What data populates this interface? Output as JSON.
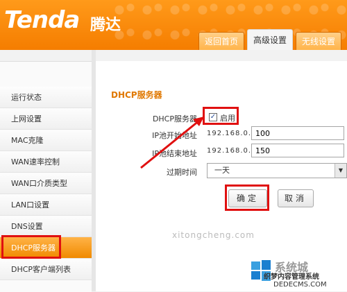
{
  "header": {
    "logo": "Tenda",
    "logo_cn": "腾达",
    "tabs": [
      {
        "label": "返回首页",
        "active": false
      },
      {
        "label": "高级设置",
        "active": true
      },
      {
        "label": "无线设置",
        "active": false
      }
    ]
  },
  "sidebar": {
    "items": [
      {
        "label": "运行状态"
      },
      {
        "label": "上网设置"
      },
      {
        "label": "MAC克隆"
      },
      {
        "label": "WAN速率控制"
      },
      {
        "label": "WAN口介质类型"
      },
      {
        "label": "LAN口设置"
      },
      {
        "label": "DNS设置"
      },
      {
        "label": "DHCP服务器",
        "active": true
      },
      {
        "label": "DHCP客户端列表"
      }
    ]
  },
  "main": {
    "section_title": "DHCP服务器",
    "dhcp_label": "DHCP服务器",
    "enable_label": "启用",
    "enable_checked": true,
    "check_mark": "✓",
    "start_label": "IP池开始地址",
    "end_label": "IP池结束地址",
    "ip_prefix": "192.168.0.",
    "start_value": "100",
    "end_value": "150",
    "lease_label": "过期时间",
    "lease_value": "一天",
    "ok_button": "确定",
    "cancel_button": "取消"
  },
  "watermark": "xitongcheng.com",
  "brand": {
    "title": "系统城",
    "slogan": "织梦内容管理系统",
    "site": "DEDECMS.COM"
  },
  "colors": {
    "header_orange": "#f57d00",
    "active_tab_bg": "#f5f5f5",
    "title_orange": "#e07800",
    "highlight_red": "#e01010"
  }
}
